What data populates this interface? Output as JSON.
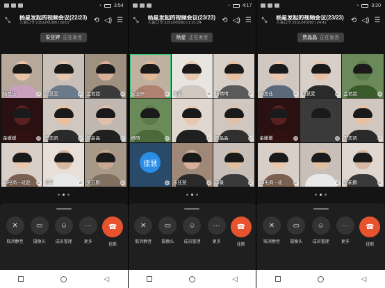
{
  "common": {
    "meeting_code_prefix": "入会口令:",
    "speaking_suffix": "正在发言",
    "controls": [
      {
        "label": "取消静音",
        "icon": "mic-off-icon",
        "glyph": "✕"
      },
      {
        "label": "摄像头",
        "icon": "camera-icon",
        "glyph": "▭"
      },
      {
        "label": "成员管理",
        "icon": "members-icon",
        "glyph": "☺"
      },
      {
        "label": "更多",
        "icon": "more-icon",
        "glyph": "···"
      },
      {
        "label": "挂断",
        "icon": "hangup-icon",
        "glyph": "☎"
      }
    ]
  },
  "phones": [
    {
      "time": "3:54",
      "title": "杨星发起的视频会议(22/23)",
      "code": "2151241090",
      "duration": "58:07",
      "speaker": "安亚婷",
      "page_dot": 1,
      "tiles": [
        {
          "name": "杨思佳",
          "bg": "#b8a89a",
          "skin": "#e8c3a8",
          "shirt": "#c9a0c0"
        },
        {
          "name": "赵慧雯",
          "bg": "#c8c0b8",
          "skin": "#e8c8b0",
          "shirt": "#6a7a8a"
        },
        {
          "name": "孟君超",
          "bg": "#a09080",
          "skin": "#d8b098",
          "shirt": "#3a3a3a"
        },
        {
          "name": "金媛媛",
          "bg": "#2a1010",
          "skin": "#5a2020",
          "shirt": "#301010"
        },
        {
          "name": "于志凯",
          "bg": "#d0c8c0",
          "skin": "#e8c0a0",
          "shirt": "#2a2a2a"
        },
        {
          "name": "贾晶晶",
          "bg": "#c0b8b0",
          "skin": "#e0c0a8",
          "shirt": "#202020"
        },
        {
          "name": "18电商一班赵",
          "bg": "#d8d0c8",
          "skin": "#e8c8b0",
          "shirt": "#7a6050"
        },
        {
          "name": "朱震",
          "bg": "#e8e0d8",
          "skin": "#d8b8a0",
          "shirt": "#e8e8e8"
        },
        {
          "name": "吴方鹏",
          "bg": "#a89888",
          "skin": "#c8a890",
          "shirt": "#807060"
        }
      ]
    },
    {
      "time": "4:17",
      "title": "杨星发起的视频会议(23/23)",
      "code": "2151241090",
      "duration": "1:21:24",
      "speaker": "杨星",
      "page_dot": 1,
      "tiles": [
        {
          "name": "安亚婷",
          "bg": "#c0b0a0",
          "skin": "#e0b898",
          "shirt": "#b08070",
          "active": true
        },
        {
          "name": "杨星",
          "bg": "#e8e4e0",
          "skin": "#e8c8b0",
          "shirt": "#d0c8c0"
        },
        {
          "name": "杨晴晴",
          "bg": "#d8d0c8",
          "skin": "#e8c0a0",
          "shirt": "#5a5a5a"
        },
        {
          "name": "杨晴",
          "bg": "#6a8a5a",
          "skin": "#5a7a4a",
          "shirt": "#4a6a3a"
        },
        {
          "name": "",
          "bg": "#e0d8d0",
          "skin": "#e8c8b0",
          "shirt": "#202020"
        },
        {
          "name": "贾晶晶",
          "bg": "#d0c8c0",
          "skin": "#e0c0a8",
          "shirt": "#303030"
        },
        {
          "name": "",
          "bg": "#2a4a6a",
          "skin": "#e8c8b0",
          "shirt": "#2a4a6a",
          "avatar": "佳慧"
        },
        {
          "name": "朱佳慧",
          "bg": "#a08878",
          "skin": "#d8b098",
          "shirt": "#2a2a2a"
        },
        {
          "name": "李豪",
          "bg": "#c8c0b8",
          "skin": "#e0c0a0",
          "shirt": "#3a3a3a"
        }
      ]
    },
    {
      "time": "3:20",
      "title": "杨星发起的视频会议(23/23)",
      "code": "2151241090",
      "duration": "24:41",
      "speaker": "贾晶晶",
      "page_dot": 1,
      "tiles": [
        {
          "name": "杨思佳",
          "bg": "#d0c8c0",
          "skin": "#e8c8b0",
          "shirt": "#5a6a7a"
        },
        {
          "name": "赵慧雯",
          "bg": "#d8d0c8",
          "skin": "#e8c0a8",
          "shirt": "#2a2a2a"
        },
        {
          "name": "孟君超",
          "bg": "#6a8a5a",
          "skin": "#5a7a4a",
          "shirt": "#3a5a2a"
        },
        {
          "name": "金媛媛",
          "bg": "#2a1010",
          "skin": "#5a2020",
          "shirt": "#301010"
        },
        {
          "name": "",
          "bg": "#3a3a3a",
          "skin": "#3a3a3a",
          "shirt": "#3a3a3a"
        },
        {
          "name": "于志凯",
          "bg": "#d0c8c0",
          "skin": "#e8c0a0",
          "shirt": "#2a2a2a"
        },
        {
          "name": "18电商一班",
          "bg": "#d8d0c8",
          "skin": "#e8c8b0",
          "shirt": "#7a6050"
        },
        {
          "name": "",
          "bg": "#c8c0b8",
          "skin": "#e0c0a0",
          "shirt": "#e8e8e8"
        },
        {
          "name": "吴新鹏",
          "bg": "#e0d8d0",
          "skin": "#d8b8a0",
          "shirt": "#3a3a3a"
        }
      ]
    }
  ]
}
